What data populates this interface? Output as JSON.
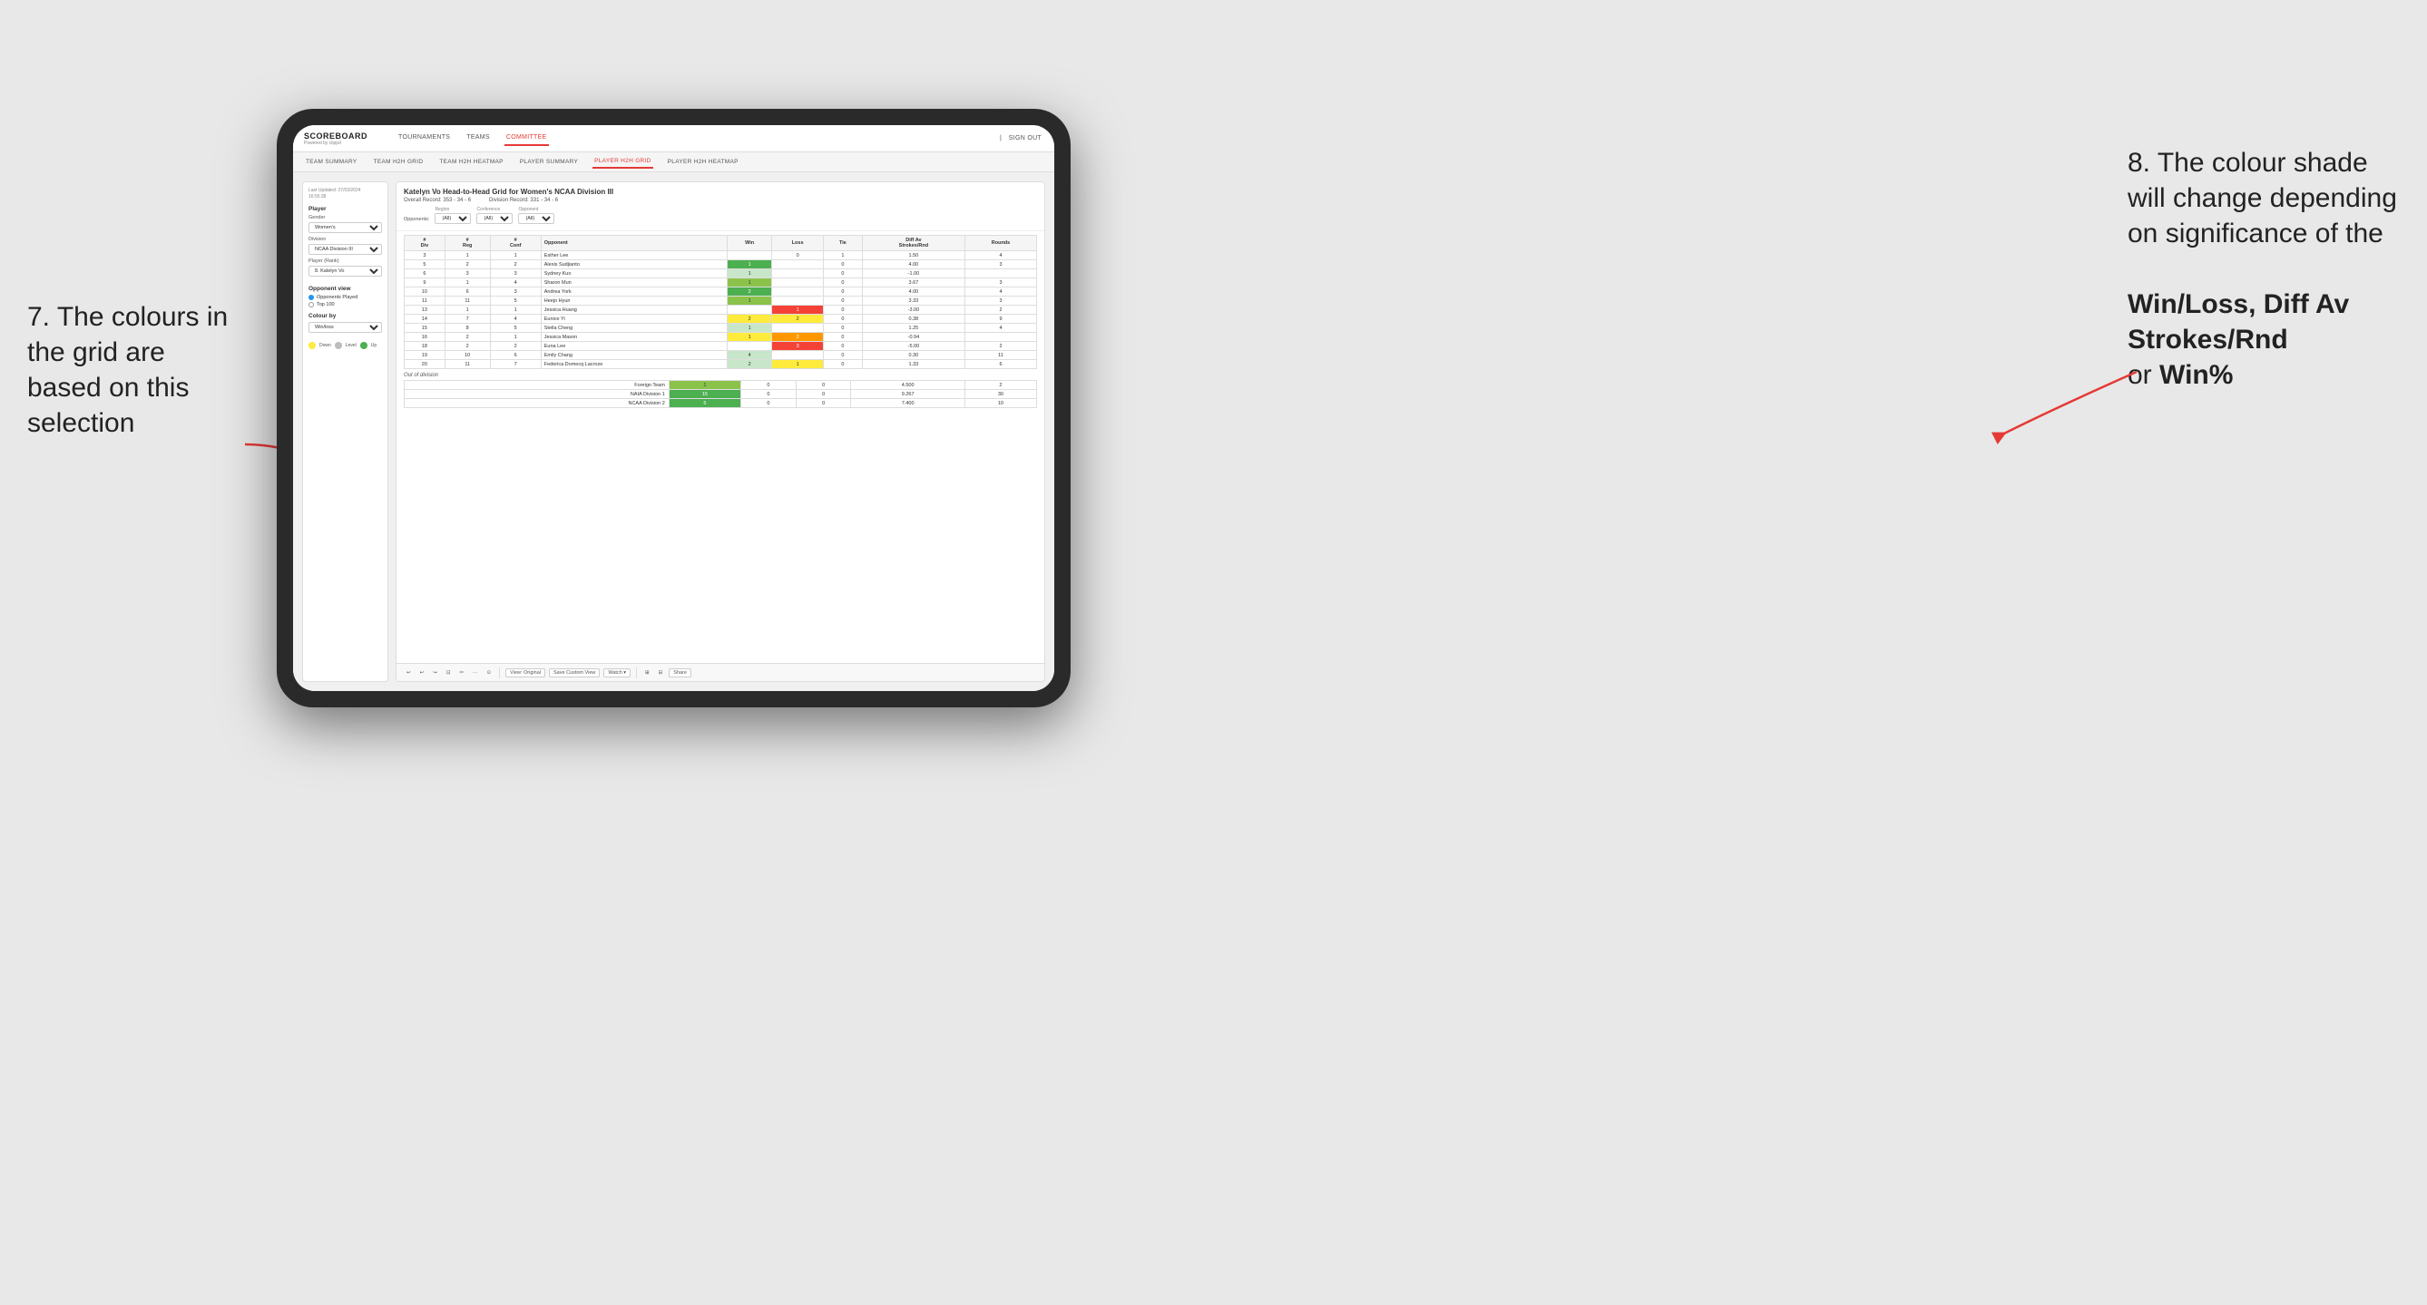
{
  "annotations": {
    "left_title": "7. The colours in the grid are based on this selection",
    "right_title": "8. The colour shade will change depending on significance of the",
    "right_bold1": "Win/Loss,",
    "right_bold2": "Diff Av Strokes/Rnd",
    "right_text": "or",
    "right_bold3": "Win%"
  },
  "nav": {
    "logo": "SCOREBOARD",
    "logo_sub": "Powered by clippd",
    "items": [
      "TOURNAMENTS",
      "TEAMS",
      "COMMITTEE"
    ],
    "active_item": "COMMITTEE",
    "sign_in_label": "Sign out"
  },
  "second_nav": {
    "items": [
      "TEAM SUMMARY",
      "TEAM H2H GRID",
      "TEAM H2H HEATMAP",
      "PLAYER SUMMARY",
      "PLAYER H2H GRID",
      "PLAYER H2H HEATMAP"
    ],
    "active_item": "PLAYER H2H GRID"
  },
  "left_panel": {
    "last_updated_label": "Last Updated: 27/03/2024",
    "last_updated_time": "16:55:38",
    "player_section": "Player",
    "gender_label": "Gender",
    "gender_value": "Women's",
    "division_label": "Division",
    "division_value": "NCAA Division III",
    "player_rank_label": "Player (Rank)",
    "player_rank_value": "8. Katelyn Vo",
    "opponent_view_title": "Opponent view",
    "radio_options": [
      "Opponents Played",
      "Top 100"
    ],
    "radio_selected": "Opponents Played",
    "colour_by_title": "Colour by",
    "colour_by_value": "Win/loss",
    "legend": [
      {
        "color": "#ffeb3b",
        "label": "Down"
      },
      {
        "color": "#bdbdbd",
        "label": "Level"
      },
      {
        "color": "#4caf50",
        "label": "Up"
      }
    ]
  },
  "grid": {
    "title": "Katelyn Vo Head-to-Head Grid for Women's NCAA Division III",
    "overall_record_label": "Overall Record:",
    "overall_record_value": "353 - 34 - 6",
    "division_record_label": "Division Record:",
    "division_record_value": "331 - 34 - 6",
    "filters": {
      "opponents_label": "Opponents:",
      "region_label": "Region",
      "region_value": "(All)",
      "conference_label": "Conference",
      "conference_value": "(All)",
      "opponent_label": "Opponent",
      "opponent_value": "(All)"
    },
    "col_headers": [
      "#\nDiv",
      "#\nReg",
      "#\nConf",
      "Opponent",
      "Win",
      "Loss",
      "Tie",
      "Diff Av\nStrokes/Rnd",
      "Rounds"
    ],
    "rows": [
      {
        "div": "3",
        "reg": "1",
        "conf": "1",
        "opponent": "Esther Lee",
        "win": "",
        "loss": "0",
        "tie": "1",
        "diff": "1.50",
        "rounds": "4",
        "win_class": "cell-white",
        "loss_class": "cell-white",
        "tie_class": "cell-white"
      },
      {
        "div": "5",
        "reg": "2",
        "conf": "2",
        "opponent": "Alexis Sudjianto",
        "win": "1",
        "loss": "",
        "tie": "0",
        "diff": "4.00",
        "rounds": "3",
        "win_class": "cell-green-dark",
        "loss_class": "cell-white",
        "tie_class": "cell-white"
      },
      {
        "div": "6",
        "reg": "3",
        "conf": "3",
        "opponent": "Sydney Kuo",
        "win": "1",
        "loss": "",
        "tie": "0",
        "diff": "-1.00",
        "rounds": "",
        "win_class": "cell-green-light",
        "loss_class": "cell-white",
        "tie_class": "cell-white"
      },
      {
        "div": "9",
        "reg": "1",
        "conf": "4",
        "opponent": "Sharon Mun",
        "win": "1",
        "loss": "",
        "tie": "0",
        "diff": "3.67",
        "rounds": "3",
        "win_class": "cell-green-med",
        "loss_class": "cell-white",
        "tie_class": "cell-white"
      },
      {
        "div": "10",
        "reg": "6",
        "conf": "3",
        "opponent": "Andrea York",
        "win": "2",
        "loss": "",
        "tie": "0",
        "diff": "4.00",
        "rounds": "4",
        "win_class": "cell-green-dark",
        "loss_class": "cell-white",
        "tie_class": "cell-white"
      },
      {
        "div": "11",
        "reg": "11",
        "conf": "5",
        "opponent": "Heejo Hyun",
        "win": "1",
        "loss": "",
        "tie": "0",
        "diff": "3.33",
        "rounds": "3",
        "win_class": "cell-green-med",
        "loss_class": "cell-white",
        "tie_class": "cell-white"
      },
      {
        "div": "13",
        "reg": "1",
        "conf": "1",
        "opponent": "Jessica Huang",
        "win": "",
        "loss": "1",
        "tie": "0",
        "diff": "-3.00",
        "rounds": "2",
        "win_class": "cell-white",
        "loss_class": "cell-red",
        "tie_class": "cell-white"
      },
      {
        "div": "14",
        "reg": "7",
        "conf": "4",
        "opponent": "Eunice Yi",
        "win": "2",
        "loss": "2",
        "tie": "0",
        "diff": "0.38",
        "rounds": "9",
        "win_class": "cell-yellow",
        "loss_class": "cell-yellow",
        "tie_class": "cell-white"
      },
      {
        "div": "15",
        "reg": "8",
        "conf": "5",
        "opponent": "Stella Cheng",
        "win": "1",
        "loss": "",
        "tie": "0",
        "diff": "1.25",
        "rounds": "4",
        "win_class": "cell-green-light",
        "loss_class": "cell-white",
        "tie_class": "cell-white"
      },
      {
        "div": "16",
        "reg": "2",
        "conf": "1",
        "opponent": "Jessica Mason",
        "win": "1",
        "loss": "2",
        "tie": "0",
        "diff": "-0.94",
        "rounds": "",
        "win_class": "cell-yellow",
        "loss_class": "cell-orange",
        "tie_class": "cell-white"
      },
      {
        "div": "18",
        "reg": "2",
        "conf": "2",
        "opponent": "Euna Lee",
        "win": "",
        "loss": "3",
        "tie": "0",
        "diff": "-5.00",
        "rounds": "2",
        "win_class": "cell-white",
        "loss_class": "cell-red",
        "tie_class": "cell-white"
      },
      {
        "div": "19",
        "reg": "10",
        "conf": "6",
        "opponent": "Emily Chang",
        "win": "4",
        "loss": "",
        "tie": "0",
        "diff": "0.30",
        "rounds": "11",
        "win_class": "cell-green-light",
        "loss_class": "cell-white",
        "tie_class": "cell-white"
      },
      {
        "div": "20",
        "reg": "11",
        "conf": "7",
        "opponent": "Federica Domecq Lacroze",
        "win": "2",
        "loss": "1",
        "tie": "0",
        "diff": "1.33",
        "rounds": "6",
        "win_class": "cell-green-light",
        "loss_class": "cell-yellow",
        "tie_class": "cell-white"
      }
    ],
    "out_of_division_title": "Out of division",
    "out_of_division_rows": [
      {
        "name": "Foreign Team",
        "win": "1",
        "loss": "0",
        "tie": "0",
        "diff": "4.500",
        "rounds": "2",
        "win_class": "cell-green-med"
      },
      {
        "name": "NAIA Division 1",
        "win": "15",
        "loss": "0",
        "tie": "0",
        "diff": "9.267",
        "rounds": "30",
        "win_class": "cell-green-dark"
      },
      {
        "name": "NCAA Division 2",
        "win": "5",
        "loss": "0",
        "tie": "0",
        "diff": "7.400",
        "rounds": "10",
        "win_class": "cell-green-dark"
      }
    ]
  },
  "toolbar": {
    "buttons": [
      "↩",
      "↩",
      "↪",
      "⊡",
      "✂",
      "·",
      "⊙",
      "|",
      "View: Original",
      "Save Custom View",
      "Watch ▾",
      "|",
      "Share"
    ]
  }
}
